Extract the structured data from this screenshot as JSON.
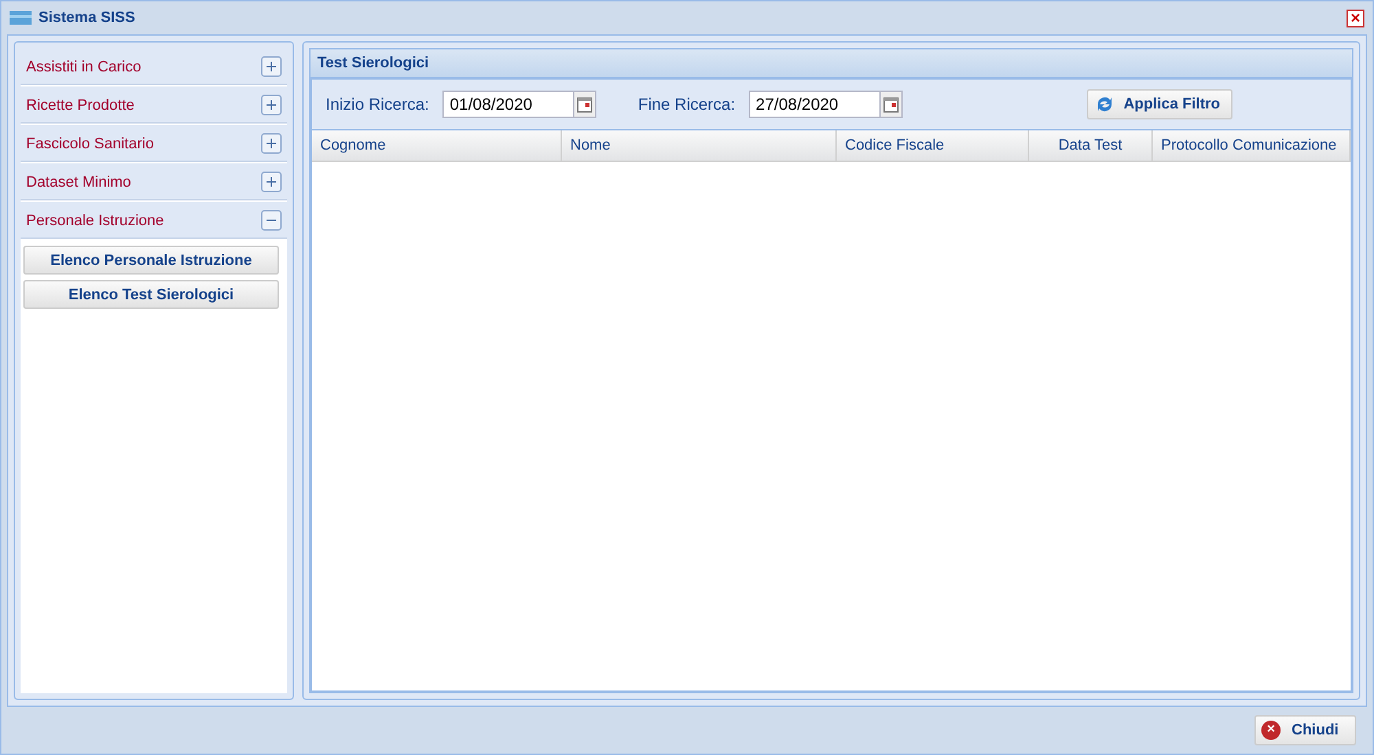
{
  "window": {
    "title": "Sistema SISS",
    "close": "×"
  },
  "sidebar": {
    "items": [
      {
        "label": "Assistiti in Carico",
        "expanded": false
      },
      {
        "label": "Ricette Prodotte",
        "expanded": false
      },
      {
        "label": "Fascicolo Sanitario",
        "expanded": false
      },
      {
        "label": "Dataset Minimo",
        "expanded": false
      },
      {
        "label": "Personale Istruzione",
        "expanded": true,
        "children": [
          {
            "label": "Elenco Personale Istruzione"
          },
          {
            "label": "Elenco Test Sierologici"
          }
        ]
      }
    ]
  },
  "panel": {
    "title": "Test Sierologici",
    "filters": [
      {
        "label": "Inizio Ricerca:",
        "value": "01/08/2020"
      },
      {
        "label": "Fine Ricerca:",
        "value": "27/08/2020"
      }
    ],
    "apply_button": "Applica Filtro",
    "table": {
      "columns": [
        {
          "label": "Cognome"
        },
        {
          "label": "Nome"
        },
        {
          "label": "Codice Fiscale"
        },
        {
          "label": "Data Test"
        },
        {
          "label": "Protocollo Comunicazione"
        }
      ]
    }
  },
  "footer": {
    "close_button": "Chiudi",
    "close_icon": "×"
  }
}
